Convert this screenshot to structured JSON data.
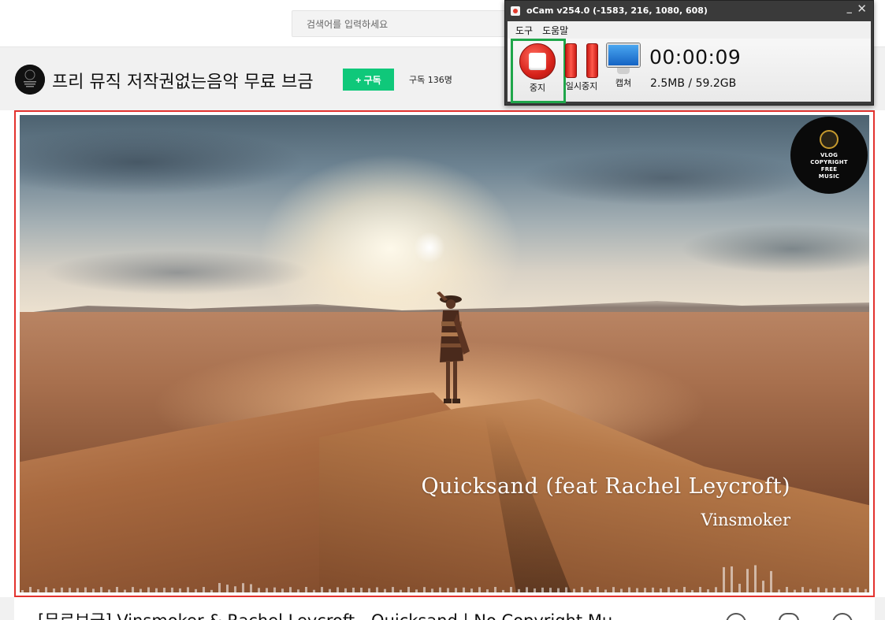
{
  "header": {
    "search_placeholder": "검색어를 입력하세요"
  },
  "channel": {
    "name": "프리 뮤직 저작권없는음악 무료 브금",
    "subscribe_label": "+ 구독",
    "subscriber_count": "구독 136명",
    "avatar_text": "VLOG COPYRIGHT FREE MUSIC"
  },
  "video": {
    "logo_lines": [
      "VLOG",
      "COPYRIGHT",
      "FREE",
      "MUSIC"
    ],
    "song_title": "Quicksand (feat Rachel Leycroft)",
    "song_artist": "Vinsmoker",
    "frame_color": "#e3322e"
  },
  "below_video": {
    "title": "[무료브금] Vinsmoker & Rachel Leycroft - Quicksand | No Copyright Mu"
  },
  "ocam": {
    "window_title": "oCam v254.0 (-1583, 216, 1080, 608)",
    "menu": [
      "도구",
      "도움말"
    ],
    "stop_label": "중지",
    "pause_label": "일시중지",
    "capture_label": "캡쳐",
    "timer": "00:00:09",
    "size": "2.5MB / 59.2GB",
    "highlight_color": "#1fa64a"
  },
  "colors": {
    "subscribe": "#0fc87a",
    "record": "#d7221a"
  }
}
